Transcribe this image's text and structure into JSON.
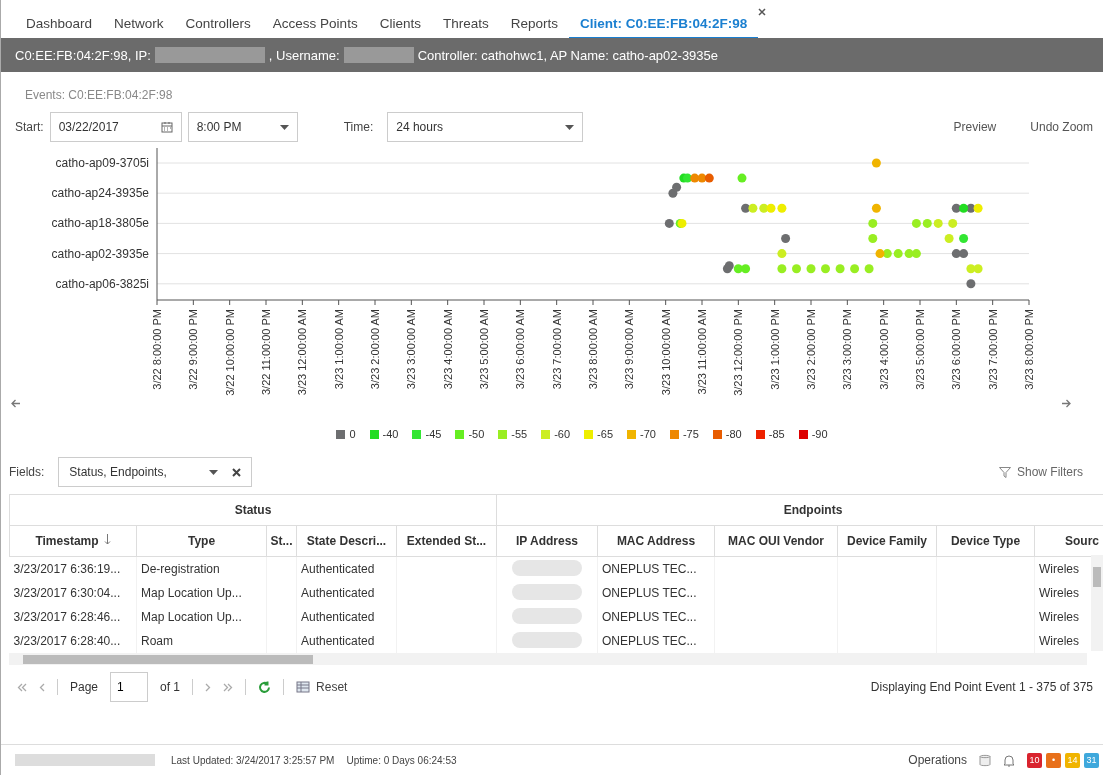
{
  "tabs": [
    {
      "label": "Dashboard",
      "selected": false
    },
    {
      "label": "Network",
      "selected": false
    },
    {
      "label": "Controllers",
      "selected": false
    },
    {
      "label": "Access Points",
      "selected": false
    },
    {
      "label": "Clients",
      "selected": false
    },
    {
      "label": "Threats",
      "selected": false
    },
    {
      "label": "Reports",
      "selected": false
    },
    {
      "label": "Client: C0:EE:FB:04:2F:98",
      "selected": true,
      "closable": true
    }
  ],
  "info_bar": [
    {
      "kind": "text",
      "text": "C0:EE:FB:04:2F:98, IP:"
    },
    {
      "kind": "redacted"
    },
    {
      "kind": "text",
      "text": ", Username:"
    },
    {
      "kind": "redacted"
    },
    {
      "kind": "text",
      "text": "Controller: cathohwc1, AP Name: catho-ap02-3935e"
    }
  ],
  "events_title": "Events: C0:EE:FB:04:2F:98",
  "controls": {
    "start_label": "Start:",
    "start_date": "03/22/2017",
    "start_time": "8:00 PM",
    "time_label": "Time:",
    "time_range": "24 hours",
    "links": [
      "Preview",
      "Undo Zoom"
    ]
  },
  "timeline": {
    "rows": [
      "catho-ap09-3705i",
      "catho-ap24-3935e",
      "catho-ap18-3805e",
      "catho-ap02-3935e",
      "catho-ap06-3825i"
    ],
    "time_labels": [
      "3/22 8:00:00 PM",
      "3/22 9:00:00 PM",
      "3/22 10:00:00 PM",
      "3/22 11:00:00 PM",
      "3/23 12:00:00 AM",
      "3/23 1:00:00 AM",
      "3/23 2:00:00 AM",
      "3/23 3:00:00 AM",
      "3/23 4:00:00 AM",
      "3/23 5:00:00 AM",
      "3/23 6:00:00 AM",
      "3/23 7:00:00 AM",
      "3/23 8:00:00 AM",
      "3/23 9:00:00 AM",
      "3/23 10:00:00 AM",
      "3/23 11:00:00 AM",
      "3/23 12:00:00 PM",
      "3/23 1:00:00 PM",
      "3/23 2:00:00 PM",
      "3/23 3:00:00 PM",
      "3/23 4:00:00 PM",
      "3/23 5:00:00 PM",
      "3/23 6:00:00 PM",
      "3/23 7:00:00 PM",
      "3/23 8:00:00 PM"
    ],
    "legend": [
      {
        "label": "0",
        "color": "#6d6e70"
      },
      {
        "label": "-40",
        "color": "#22dd22"
      },
      {
        "label": "-45",
        "color": "#33e633"
      },
      {
        "label": "-50",
        "color": "#66ee22"
      },
      {
        "label": "-55",
        "color": "#99ee22"
      },
      {
        "label": "-60",
        "color": "#ccee22"
      },
      {
        "label": "-65",
        "color": "#eeee00"
      },
      {
        "label": "-70",
        "color": "#f0b400"
      },
      {
        "label": "-75",
        "color": "#ee8800"
      },
      {
        "label": "-80",
        "color": "#e85c00"
      },
      {
        "label": "-85",
        "color": "#ee2200"
      },
      {
        "label": "-90",
        "color": "#dd0000"
      }
    ]
  },
  "fields": {
    "label": "Fields:",
    "value": "Status, Endpoints,",
    "show_filters": "Show Filters"
  },
  "table": {
    "groups": [
      "Status",
      "Endpoints"
    ],
    "columns": [
      {
        "label": "Timestamp",
        "sorted": true
      },
      {
        "label": "Type",
        "sorted": false
      },
      {
        "label": "St...",
        "sorted": false
      },
      {
        "label": "State Descri...",
        "sorted": false
      },
      {
        "label": "Extended St...",
        "sorted": false
      },
      {
        "label": "IP Address",
        "sorted": false
      },
      {
        "label": "MAC Address",
        "sorted": false
      },
      {
        "label": "MAC OUI Vendor",
        "sorted": false
      },
      {
        "label": "Device Family",
        "sorted": false
      },
      {
        "label": "Device Type",
        "sorted": false
      },
      {
        "label": "Sourc",
        "sorted": false
      }
    ],
    "rows": [
      [
        "3/23/2017 6:36:19...",
        "De-registration",
        "",
        "Authenticated",
        "",
        null,
        "ONEPLUS TEC...",
        "",
        "",
        "",
        "Wireles"
      ],
      [
        "3/23/2017 6:30:04...",
        "Map Location Up...",
        "",
        "Authenticated",
        "",
        null,
        "ONEPLUS TEC...",
        "",
        "",
        "",
        "Wireles"
      ],
      [
        "3/23/2017 6:28:46...",
        "Map Location Up...",
        "",
        "Authenticated",
        "",
        null,
        "ONEPLUS TEC...",
        "",
        "",
        "",
        "Wireles"
      ],
      [
        "3/23/2017 6:28:40...",
        "Roam",
        "",
        "Authenticated",
        "",
        null,
        "ONEPLUS TEC...",
        "",
        "",
        "",
        "Wireles"
      ]
    ]
  },
  "paging": {
    "page_label": "Page",
    "page": "1",
    "of": "of 1",
    "reset": "Reset",
    "summary": "Displaying End Point Event 1 - 375 of 375"
  },
  "status_bar": {
    "updated": "Last Updated: 3/24/2017 3:25:57 PM",
    "uptime": "Uptime: 0 Days 06:24:53",
    "operations": "Operations",
    "badges": [
      {
        "text": "10",
        "color": "#d9232e"
      },
      {
        "text": "•",
        "color": "#e8701a"
      },
      {
        "text": "14",
        "color": "#f0b400"
      },
      {
        "text": "31",
        "color": "#3ea8dc"
      }
    ]
  }
}
